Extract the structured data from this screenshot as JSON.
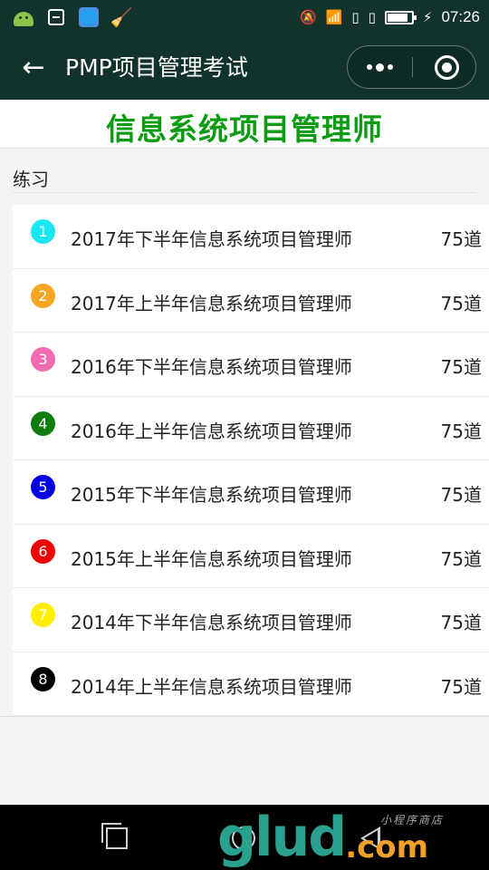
{
  "status_bar": {
    "time": "07:26",
    "icons": [
      "android-icon",
      "scan-icon",
      "globe-icon",
      "broom-icon",
      "bell-off-icon",
      "wifi-icon",
      "sim-icon",
      "sim-icon",
      "battery-icon",
      "charging-icon"
    ]
  },
  "navbar": {
    "title": "PMP项目管理考试",
    "back_icon": "arrow-left-icon",
    "more_icon": "more-dots-icon",
    "close_icon": "target-close-icon"
  },
  "heading": "信息系统项目管理师",
  "section_label": "练习",
  "items": [
    {
      "num": "1",
      "title": "2017年下半年信息系统项目管理师",
      "count": "75道",
      "color": "#19e6f0"
    },
    {
      "num": "2",
      "title": "2017年上半年信息系统项目管理师",
      "count": "75道",
      "color": "#f5a623"
    },
    {
      "num": "3",
      "title": "2016年下半年信息系统项目管理师",
      "count": "75道",
      "color": "#f26bb0"
    },
    {
      "num": "4",
      "title": "2016年上半年信息系统项目管理师",
      "count": "75道",
      "color": "#0d7d0d"
    },
    {
      "num": "5",
      "title": "2015年下半年信息系统项目管理师",
      "count": "75道",
      "color": "#0000e6"
    },
    {
      "num": "6",
      "title": "2015年上半年信息系统项目管理师",
      "count": "75道",
      "color": "#f00000"
    },
    {
      "num": "7",
      "title": "2014年下半年信息系统项目管理师",
      "count": "75道",
      "color": "#ffee00"
    },
    {
      "num": "8",
      "title": "2014年上半年信息系统项目管理师",
      "count": "75道",
      "color": "#000000"
    }
  ],
  "watermark": {
    "main": "glud",
    "suffix": ".com",
    "small": "小程序商店"
  }
}
